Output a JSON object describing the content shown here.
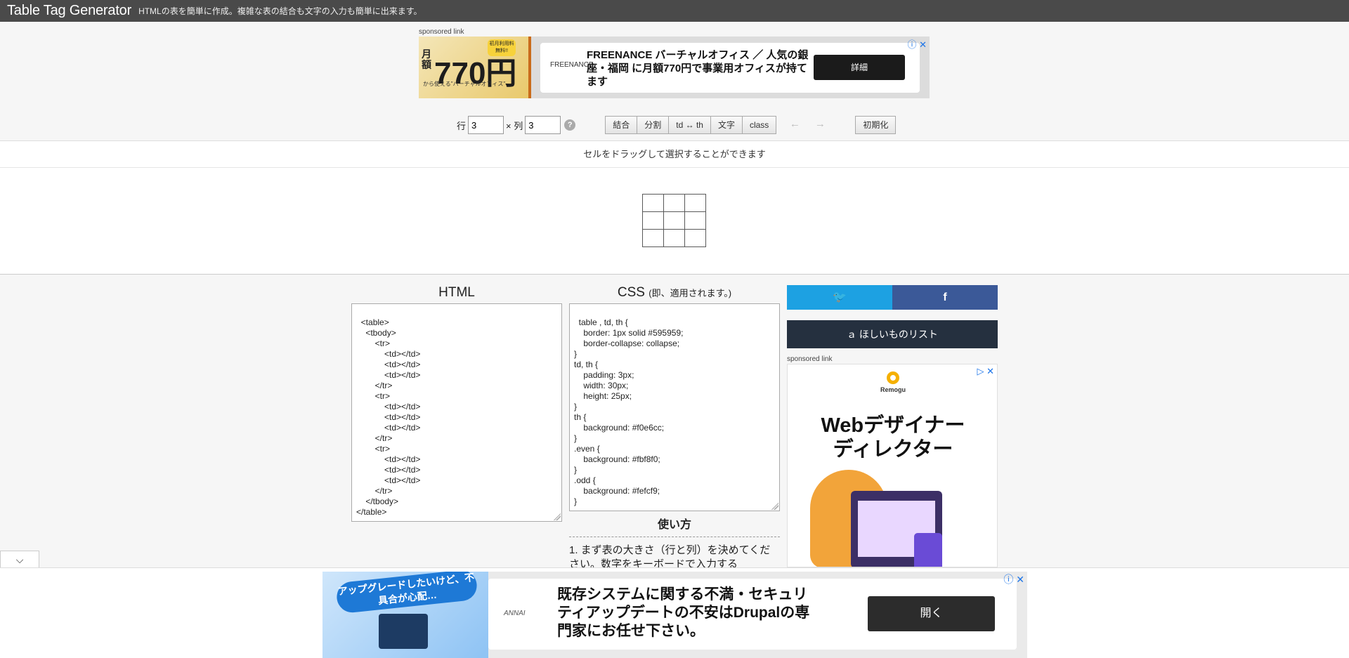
{
  "header": {
    "title": "Table Tag Generator",
    "tagline": "HTMLの表を簡単に作成。複雑な表の結合も文字の入力も簡単に出来ます。"
  },
  "ads": {
    "sponsored_label": "sponsored link",
    "top": {
      "image_prefix": "月額",
      "image_number": "770円",
      "image_sub": "から使える\"バーチャルオフィス\"",
      "image_badge": "初月利用料無料!!",
      "logo": "FREENANCE",
      "text": "FREENANCE バーチャルオフィス ／ 人気の銀座・福岡 に月額770円で事業用オフィスが持てます",
      "button": "詳細",
      "close": "ⓘ ✕"
    },
    "side": {
      "brand": "Remogu",
      "headline": "Webデザイナー\nディレクター",
      "close": "▷ ✕"
    },
    "bottom": {
      "bubble": "アップグレードしたいけど、不具合が心配…",
      "brand": "ANNAI",
      "text": "既存システムに関する不満・セキュリティアップデートの不安はDrupalの専門家にお任せ下さい。",
      "button": "開く",
      "close": "ⓘ ✕"
    }
  },
  "controls": {
    "rows_label": "行",
    "rows_value": "3",
    "cols_label": "× 列",
    "cols_value": "3",
    "help": "?",
    "buttons": [
      "結合",
      "分割",
      "td ↔ th",
      "文字",
      "class"
    ],
    "prev_arrow": "←",
    "next_arrow": "→",
    "reset": "初期化"
  },
  "editor": {
    "hint": "セルをドラッグして選択することができます",
    "rows": 3,
    "cols": 3
  },
  "html_pane": {
    "title": "HTML",
    "code": "<table>\n\t<tbody>\n\t\t<tr>\n\t\t\t<td></td>\n\t\t\t<td></td>\n\t\t\t<td></td>\n\t\t</tr>\n\t\t<tr>\n\t\t\t<td></td>\n\t\t\t<td></td>\n\t\t\t<td></td>\n\t\t</tr>\n\t\t<tr>\n\t\t\t<td></td>\n\t\t\t<td></td>\n\t\t\t<td></td>\n\t\t</tr>\n\t</tbody>\n</table>"
  },
  "css_pane": {
    "title": "CSS",
    "note": "(即、適用されます。)",
    "code": "table , td, th {\n\tborder: 1px solid #595959;\n\tborder-collapse: collapse;\n}\ntd, th {\n\tpadding: 3px;\n\twidth: 30px;\n\theight: 25px;\n}\nth {\n\tbackground: #f0e6cc;\n}\n.even {\n\tbackground: #fbf8f0;\n}\n.odd {\n\tbackground: #fefcf9;\n}"
  },
  "usage": {
    "title": "使い方",
    "text": "1. まず表の大きさ（行と列）を決めてください。数字をキーボードで入力する"
  },
  "share": {
    "twitter": "🐦",
    "facebook": "f",
    "wishlist": "ａ ほしいものリスト"
  },
  "collapse_icon": "⌵",
  "colors": {
    "topbar": "#4a4a4a",
    "twitter": "#1da1e2",
    "facebook": "#3b5998",
    "wishlist": "#25303f"
  }
}
